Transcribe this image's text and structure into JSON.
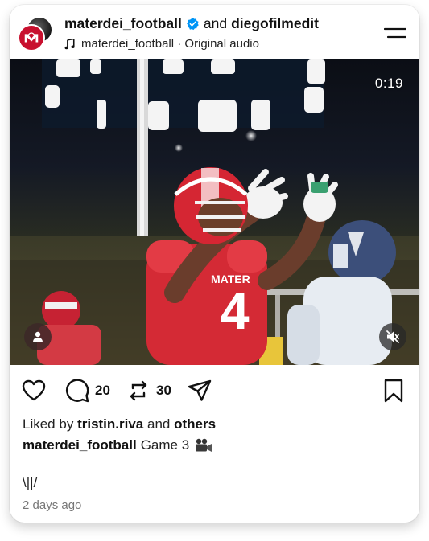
{
  "header": {
    "account_primary": "materdei_football",
    "connector": "and",
    "account_secondary": "diegofilmedit",
    "audio_label": "materdei_football · Original audio"
  },
  "video": {
    "timer": "0:19"
  },
  "actions": {
    "comment_count": "20",
    "repost_count": "30"
  },
  "likes": {
    "prefix": "Liked by",
    "user": "tristin.riva",
    "joiner": "and",
    "others": "others"
  },
  "caption": {
    "author": "materdei_football",
    "text": "Game 3"
  },
  "extra_text": "\\||/",
  "time_ago": "2 days ago",
  "colors": {
    "brand_red": "#c8102e",
    "verified_blue": "#0095f6"
  },
  "icons": [
    "heart-icon",
    "comment-icon",
    "repost-icon",
    "share-icon",
    "bookmark-icon",
    "music-note-icon",
    "verified-badge-icon",
    "menu-icon",
    "person-icon",
    "muted-speaker-icon",
    "video-camera-icon"
  ]
}
